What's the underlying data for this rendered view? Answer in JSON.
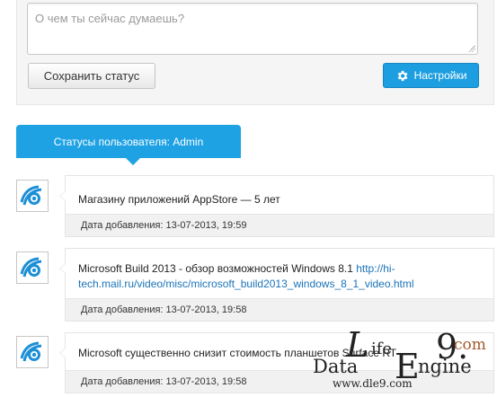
{
  "status_form": {
    "placeholder": "О чем ты сейчас думаешь?",
    "save_label": "Сохранить статус",
    "settings_label": "Настройки"
  },
  "statuses_tab": {
    "label": "Статусы пользователя: Admin"
  },
  "statuses": [
    {
      "text": "Магазину приложений AppStore — 5 лет",
      "date": "Дата добавления: 13-07-2013, 19:59"
    },
    {
      "text": "Microsoft Build 2013 - обзор возможностей Windows 8.1 ",
      "link": "http://hi-tech.mail.ru/video/misc/microsoft_build2013_windows_8_1_video.html",
      "date": "Дата добавления: 13-07-2013, 19:58"
    },
    {
      "text": "Microsoft существенно снизит стоимость планшетов Surface RT",
      "date": "Дата добавления: 13-07-2013, 19:58"
    }
  ],
  "watermark": {
    "l": "L",
    "ife": "ife",
    "nine": "9.",
    "com": "com",
    "data": "Data",
    "e": "E",
    "ngine": "ngine",
    "url": "www.dle9.com"
  },
  "colors": {
    "accent": "#1ea2e4",
    "link": "#1a73b8",
    "avatar_icon": "#1d8fd6"
  }
}
